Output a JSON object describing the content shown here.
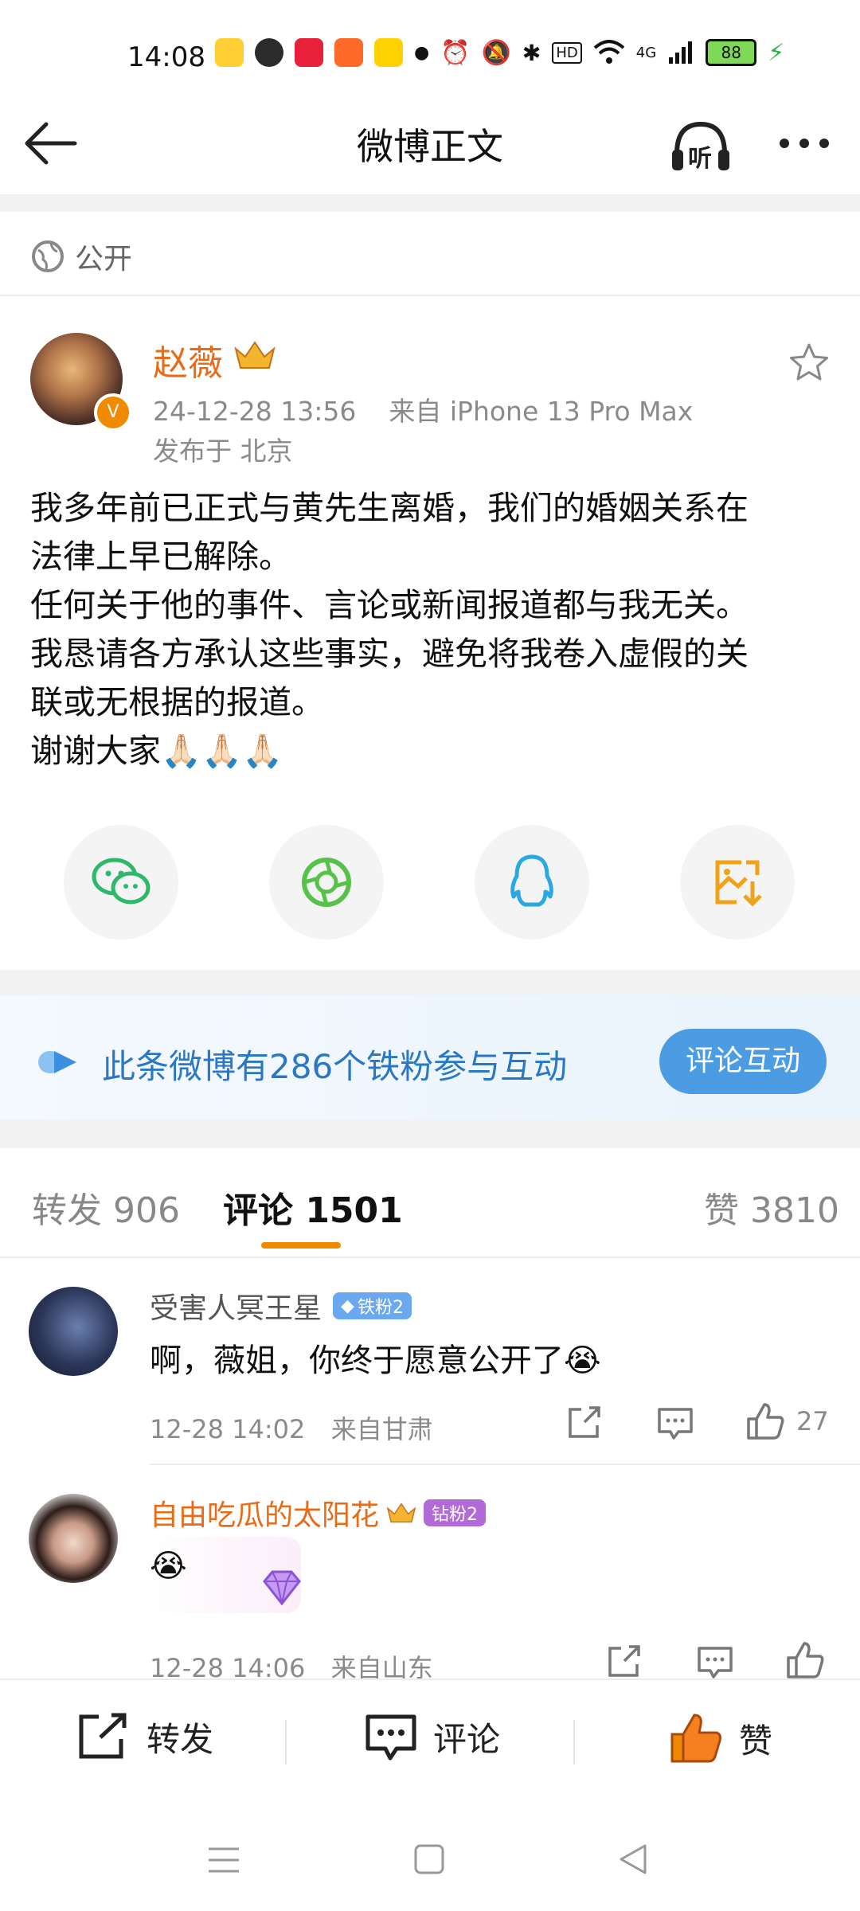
{
  "status_bar": {
    "time": "14:08",
    "battery": "88",
    "network": "4G",
    "hd": "HD",
    "app_icons": [
      "weibo-icon",
      "wechat-icon",
      "xiaohongshu-icon",
      "taobao-icon",
      "meituan-icon"
    ],
    "system_icons": [
      "alarm-icon",
      "mute-icon",
      "bluetooth-icon",
      "hd-icon",
      "wifi-icon",
      "signal-icon",
      "battery-icon",
      "charging-icon"
    ]
  },
  "nav": {
    "title": "微博正文",
    "listen_label": "听"
  },
  "visibility": {
    "label": "公开"
  },
  "post": {
    "author": "赵薇",
    "time": "24-12-28 13:56",
    "source": "来自 iPhone 13 Pro Max",
    "location": "发布于 北京",
    "lines": [
      "我多年前已正式与黄先生离婚，我们的婚姻关系在",
      "法律上早已解除。",
      "任何关于他的事件、言论或新闻报道都与我无关。",
      "我恳请各方承认这些事实，避免将我卷入虚假的关",
      "联或无根据的报道。",
      "谢谢大家🙏🏻🙏🏻🙏🏻"
    ]
  },
  "share": {
    "items": [
      "wechat",
      "moments",
      "qq",
      "save-image"
    ]
  },
  "fans_banner": {
    "text": "此条微博有286个铁粉参与互动",
    "button": "评论互动"
  },
  "tabs": {
    "repost": "转发 906",
    "comment": "评论 1501",
    "like": "赞 3810"
  },
  "comments": [
    {
      "user": "受害人冥王星",
      "badge": "铁粉2",
      "text": "啊，薇姐，你终于愿意公开了😭",
      "time": "12-28 14:02",
      "location": "来自甘肃",
      "likes": "27"
    },
    {
      "user": "自由吃瓜的太阳花",
      "badge": "钻粉2",
      "text": "😭",
      "time": "12-28 14:06",
      "location": "来自山东",
      "likes": ""
    }
  ],
  "bottom_bar": {
    "repost": "转发",
    "comment": "评论",
    "like": "赞"
  },
  "colors": {
    "accent_orange": "#f08a00",
    "name_orange": "#e86b17",
    "link_blue": "#2a78c5",
    "button_blue": "#4b9ce3"
  }
}
